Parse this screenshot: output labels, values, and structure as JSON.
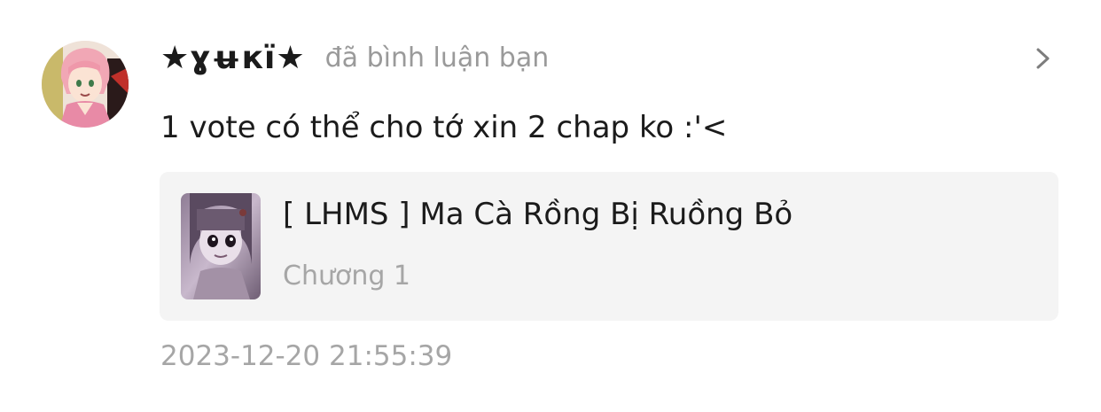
{
  "notification": {
    "user": {
      "name": "★ɣʉкï★",
      "avatar_icon": "user-avatar"
    },
    "action_text": "đã bình luận bạn",
    "comment_text": "1 vote có thể cho tớ xin 2 chap ko :'<",
    "reference": {
      "title": "[ LHMS ] Ma Cà Rồng Bị Ruồng Bỏ",
      "chapter": "Chương 1",
      "thumbnail_icon": "manga-cover-thumbnail"
    },
    "timestamp": "2023-12-20 21:55:39",
    "open_icon": "chevron-right-icon"
  },
  "colors": {
    "primary_text": "#1b1b1b",
    "secondary_text": "#9a9a9a",
    "card_background": "#f4f4f4"
  }
}
